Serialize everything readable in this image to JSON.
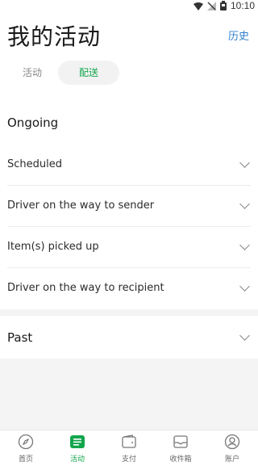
{
  "status_bar": {
    "time": "10:10",
    "icons": [
      "wifi-icon",
      "no-signal-icon",
      "battery-icon"
    ]
  },
  "header": {
    "title": "我的活动",
    "history_label": "历史"
  },
  "tabs": [
    {
      "label": "活动",
      "active": false
    },
    {
      "label": "配送",
      "active": true
    }
  ],
  "ongoing": {
    "heading": "Ongoing",
    "items": [
      {
        "label": "Scheduled"
      },
      {
        "label": "Driver on the way to sender"
      },
      {
        "label": "Item(s) picked up"
      },
      {
        "label": "Driver on the way to recipient"
      }
    ]
  },
  "past": {
    "heading": "Past"
  },
  "bottom_nav": [
    {
      "label": "首页",
      "icon": "compass-icon",
      "active": false
    },
    {
      "label": "活动",
      "icon": "activity-list-icon",
      "active": true
    },
    {
      "label": "支付",
      "icon": "wallet-icon",
      "active": false
    },
    {
      "label": "收件箱",
      "icon": "inbox-icon",
      "active": false
    },
    {
      "label": "账户",
      "icon": "account-icon",
      "active": false
    }
  ],
  "colors": {
    "accent": "#12a64c",
    "link": "#2f7fcd",
    "divider": "#ececec",
    "background_band": "#f4f4f4"
  }
}
